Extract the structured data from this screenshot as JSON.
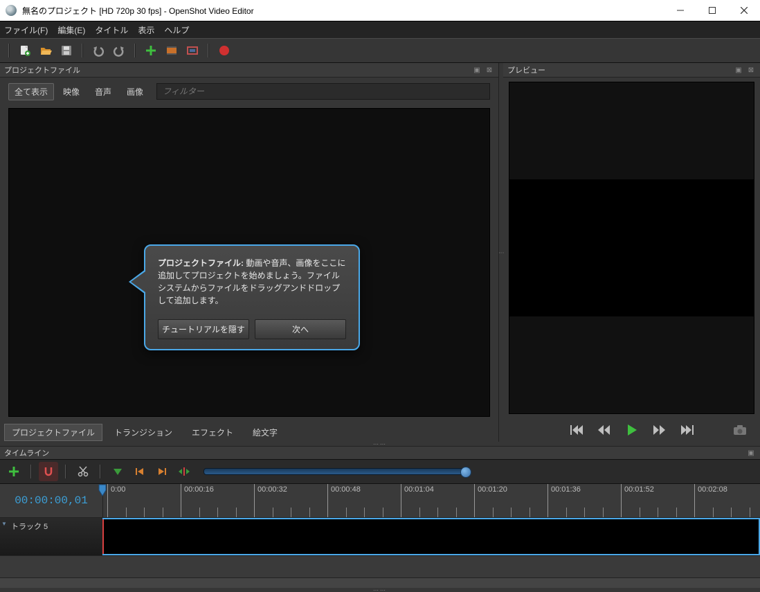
{
  "window": {
    "title": "無名のプロジェクト [HD 720p 30 fps] - OpenShot Video Editor"
  },
  "menu": {
    "file": "ファイル(F)",
    "edit": "編集(E)",
    "title": "タイトル",
    "view": "表示",
    "help": "ヘルプ"
  },
  "panels": {
    "project": "プロジェクトファイル",
    "preview": "プレビュー",
    "timeline": "タイムライン"
  },
  "project_filter": {
    "all": "全て表示",
    "video": "映像",
    "audio": "音声",
    "image": "画像",
    "placeholder": "フィルター"
  },
  "project_tabs": {
    "files": "プロジェクトファイル",
    "transitions": "トランジション",
    "effects": "エフェクト",
    "emoji": "絵文字"
  },
  "timeline": {
    "timecode": "00:00:00,01",
    "track_label": "トラック 5",
    "ticks": [
      "0:00",
      "00:00:16",
      "00:00:32",
      "00:00:48",
      "00:01:04",
      "00:01:20",
      "00:01:36",
      "00:01:52",
      "00:02:08"
    ]
  },
  "tutorial": {
    "heading": "プロジェクトファイル:",
    "body": " 動画や音声、画像をここに追加してプロジェクトを始めましょう。ファイルシステムからファイルをドラッグアンドドロップして追加します。",
    "hide": "チュートリアルを隠す",
    "next": "次へ"
  }
}
